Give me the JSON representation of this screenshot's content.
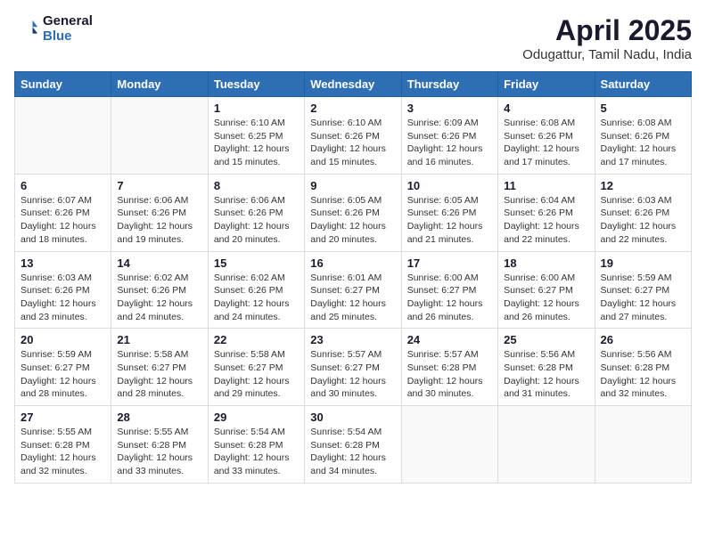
{
  "header": {
    "logo_line1": "General",
    "logo_line2": "Blue",
    "month": "April 2025",
    "location": "Odugattur, Tamil Nadu, India"
  },
  "weekdays": [
    "Sunday",
    "Monday",
    "Tuesday",
    "Wednesday",
    "Thursday",
    "Friday",
    "Saturday"
  ],
  "weeks": [
    [
      {
        "day": "",
        "info": ""
      },
      {
        "day": "",
        "info": ""
      },
      {
        "day": "1",
        "info": "Sunrise: 6:10 AM\nSunset: 6:25 PM\nDaylight: 12 hours and 15 minutes."
      },
      {
        "day": "2",
        "info": "Sunrise: 6:10 AM\nSunset: 6:26 PM\nDaylight: 12 hours and 15 minutes."
      },
      {
        "day": "3",
        "info": "Sunrise: 6:09 AM\nSunset: 6:26 PM\nDaylight: 12 hours and 16 minutes."
      },
      {
        "day": "4",
        "info": "Sunrise: 6:08 AM\nSunset: 6:26 PM\nDaylight: 12 hours and 17 minutes."
      },
      {
        "day": "5",
        "info": "Sunrise: 6:08 AM\nSunset: 6:26 PM\nDaylight: 12 hours and 17 minutes."
      }
    ],
    [
      {
        "day": "6",
        "info": "Sunrise: 6:07 AM\nSunset: 6:26 PM\nDaylight: 12 hours and 18 minutes."
      },
      {
        "day": "7",
        "info": "Sunrise: 6:06 AM\nSunset: 6:26 PM\nDaylight: 12 hours and 19 minutes."
      },
      {
        "day": "8",
        "info": "Sunrise: 6:06 AM\nSunset: 6:26 PM\nDaylight: 12 hours and 20 minutes."
      },
      {
        "day": "9",
        "info": "Sunrise: 6:05 AM\nSunset: 6:26 PM\nDaylight: 12 hours and 20 minutes."
      },
      {
        "day": "10",
        "info": "Sunrise: 6:05 AM\nSunset: 6:26 PM\nDaylight: 12 hours and 21 minutes."
      },
      {
        "day": "11",
        "info": "Sunrise: 6:04 AM\nSunset: 6:26 PM\nDaylight: 12 hours and 22 minutes."
      },
      {
        "day": "12",
        "info": "Sunrise: 6:03 AM\nSunset: 6:26 PM\nDaylight: 12 hours and 22 minutes."
      }
    ],
    [
      {
        "day": "13",
        "info": "Sunrise: 6:03 AM\nSunset: 6:26 PM\nDaylight: 12 hours and 23 minutes."
      },
      {
        "day": "14",
        "info": "Sunrise: 6:02 AM\nSunset: 6:26 PM\nDaylight: 12 hours and 24 minutes."
      },
      {
        "day": "15",
        "info": "Sunrise: 6:02 AM\nSunset: 6:26 PM\nDaylight: 12 hours and 24 minutes."
      },
      {
        "day": "16",
        "info": "Sunrise: 6:01 AM\nSunset: 6:27 PM\nDaylight: 12 hours and 25 minutes."
      },
      {
        "day": "17",
        "info": "Sunrise: 6:00 AM\nSunset: 6:27 PM\nDaylight: 12 hours and 26 minutes."
      },
      {
        "day": "18",
        "info": "Sunrise: 6:00 AM\nSunset: 6:27 PM\nDaylight: 12 hours and 26 minutes."
      },
      {
        "day": "19",
        "info": "Sunrise: 5:59 AM\nSunset: 6:27 PM\nDaylight: 12 hours and 27 minutes."
      }
    ],
    [
      {
        "day": "20",
        "info": "Sunrise: 5:59 AM\nSunset: 6:27 PM\nDaylight: 12 hours and 28 minutes."
      },
      {
        "day": "21",
        "info": "Sunrise: 5:58 AM\nSunset: 6:27 PM\nDaylight: 12 hours and 28 minutes."
      },
      {
        "day": "22",
        "info": "Sunrise: 5:58 AM\nSunset: 6:27 PM\nDaylight: 12 hours and 29 minutes."
      },
      {
        "day": "23",
        "info": "Sunrise: 5:57 AM\nSunset: 6:27 PM\nDaylight: 12 hours and 30 minutes."
      },
      {
        "day": "24",
        "info": "Sunrise: 5:57 AM\nSunset: 6:28 PM\nDaylight: 12 hours and 30 minutes."
      },
      {
        "day": "25",
        "info": "Sunrise: 5:56 AM\nSunset: 6:28 PM\nDaylight: 12 hours and 31 minutes."
      },
      {
        "day": "26",
        "info": "Sunrise: 5:56 AM\nSunset: 6:28 PM\nDaylight: 12 hours and 32 minutes."
      }
    ],
    [
      {
        "day": "27",
        "info": "Sunrise: 5:55 AM\nSunset: 6:28 PM\nDaylight: 12 hours and 32 minutes."
      },
      {
        "day": "28",
        "info": "Sunrise: 5:55 AM\nSunset: 6:28 PM\nDaylight: 12 hours and 33 minutes."
      },
      {
        "day": "29",
        "info": "Sunrise: 5:54 AM\nSunset: 6:28 PM\nDaylight: 12 hours and 33 minutes."
      },
      {
        "day": "30",
        "info": "Sunrise: 5:54 AM\nSunset: 6:28 PM\nDaylight: 12 hours and 34 minutes."
      },
      {
        "day": "",
        "info": ""
      },
      {
        "day": "",
        "info": ""
      },
      {
        "day": "",
        "info": ""
      }
    ]
  ]
}
